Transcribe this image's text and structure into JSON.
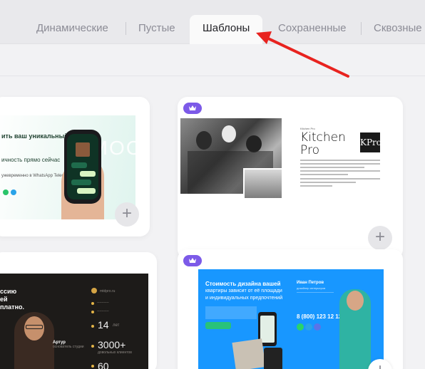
{
  "tabs": [
    {
      "label": "Динамические",
      "active": false
    },
    {
      "label": "Пустые",
      "active": false
    },
    {
      "label": "Шаблоны",
      "active": true
    },
    {
      "label": "Сохраненные",
      "active": false
    },
    {
      "label": "Сквозные",
      "active": false
    }
  ],
  "templates": {
    "mint": {
      "heading": "ить ваш уникальный",
      "sub": "ичность прямо сейчас",
      "desc": "ужевременно в WhatsApp Telegram"
    },
    "kitchen": {
      "title": "Kitchen Pro",
      "title_line1": "Kitchen",
      "title_line2": "Pro",
      "logo": "KPro"
    },
    "dark": {
      "headline_1": "ссию",
      "headline_2": "ей",
      "headline_3": "платно.",
      "person_name": "Артур",
      "stat_1": "14",
      "stat_1_unit": "лет",
      "stat_2": "3000+",
      "stat_3": "60"
    },
    "blue": {
      "headline_1": "Стоимость дизайна вашей",
      "headline_2": "квартиры зависит от её площади",
      "headline_3": "и индивидуальных предпочтений",
      "name": "Иван Петров",
      "phone": "8 (800) 123 12 12"
    }
  },
  "colors": {
    "accent_red": "#e8231f",
    "badge_purple": "#7c5ae8",
    "blue_template": "#1897ff"
  },
  "icons": {
    "badge": "crown-icon",
    "add": "plus-icon"
  }
}
